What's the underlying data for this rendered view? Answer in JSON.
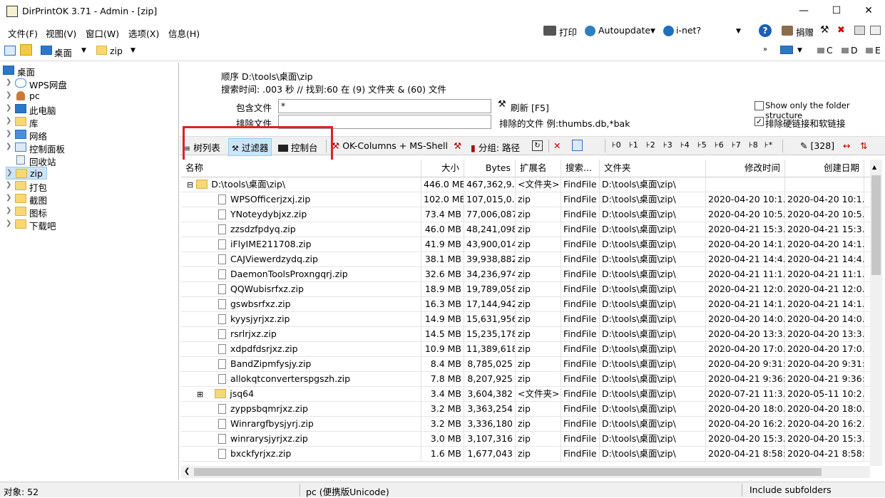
{
  "window": {
    "title": "DirPrintOK 3.71 - Admin - [zip]"
  },
  "menu": [
    "文件(F)",
    "视图(V)",
    "窗口(W)",
    "选项(X)",
    "信息(H)"
  ],
  "toolbar": {
    "print": "打印",
    "autoupdate": "Autoupdate",
    "inet": "i-net?",
    "donate": "捐赠"
  },
  "nav": {
    "desktop": "桌面",
    "zip": "zip",
    "drives": [
      "C",
      "D",
      "E"
    ]
  },
  "tree": [
    {
      "label": "桌面",
      "icon": "desktop-icon"
    },
    {
      "label": "WPS网盘",
      "icon": "cloud-icon"
    },
    {
      "label": "pc",
      "icon": "user-icon"
    },
    {
      "label": "此电脑",
      "icon": "computer-icon"
    },
    {
      "label": "库",
      "icon": "library-icon"
    },
    {
      "label": "网络",
      "icon": "network-icon"
    },
    {
      "label": "控制面板",
      "icon": "control-panel-icon"
    },
    {
      "label": "回收站",
      "icon": "recycle-bin-icon"
    },
    {
      "label": "zip",
      "icon": "folder-icon"
    },
    {
      "label": "打包",
      "icon": "folder-icon"
    },
    {
      "label": "截图",
      "icon": "folder-icon"
    },
    {
      "label": "图标",
      "icon": "folder-icon"
    },
    {
      "label": "下载吧",
      "icon": "folder-icon"
    }
  ],
  "info": {
    "order": "顺序   D:\\tools\\桌面\\zip",
    "search": "搜索时间: .003 秒 //  找到:60 在 (9) 文件夹 & (60) 文件"
  },
  "filter": {
    "include_label": "包含文件",
    "include_value": "*",
    "exclude_label": "排除文件",
    "exclude_value": "",
    "refresh": "刷新 [F5]",
    "exclude_hint": "排除的文件 例:thumbs.db,*bak",
    "only_folder": "Show only the folder structure",
    "exclude_links": "排除硬链接和软链接"
  },
  "toolbar3": {
    "treelist": "树列表",
    "filter": "过滤器",
    "console": "控制台",
    "ok_columns": "OK-Columns + MS-Shell",
    "group": "分组: 路径",
    "levels": [
      "0",
      "1",
      "2",
      "3",
      "4",
      "5",
      "6",
      "7",
      "8",
      "*"
    ],
    "count": "[328]"
  },
  "columns": [
    "名称",
    "大小",
    "Bytes",
    "扩展名",
    "搜索...",
    "文件夹",
    "修改时间",
    "创建日期"
  ],
  "rows": [
    {
      "name": "D:\\tools\\桌面\\zip\\",
      "size": "446.0 MB",
      "bytes": "467,362,9...",
      "ext": "<文件夹>",
      "search": "FindFile",
      "folder": "D:\\tools\\桌面\\zip\\",
      "mtime": "",
      "ctime": "",
      "type": "root"
    },
    {
      "name": "WPSOfficerjzxj.zip",
      "size": "102.0 MB",
      "bytes": "107,015,0...",
      "ext": "zip",
      "search": "FindFile",
      "folder": "D:\\tools\\桌面\\zip\\",
      "mtime": "2020-04-20 10:1...",
      "ctime": "2020-04-20 10:1...",
      "type": "file"
    },
    {
      "name": "YNoteydybjxz.zip",
      "size": "73.4 MB",
      "bytes": "77,006,087",
      "ext": "zip",
      "search": "FindFile",
      "folder": "D:\\tools\\桌面\\zip\\",
      "mtime": "2020-04-20 10:5...",
      "ctime": "2020-04-20 10:5...",
      "type": "file"
    },
    {
      "name": "zzsdzfpdyq.zip",
      "size": "46.0 MB",
      "bytes": "48,241,098",
      "ext": "zip",
      "search": "FindFile",
      "folder": "D:\\tools\\桌面\\zip\\",
      "mtime": "2020-04-21 15:3...",
      "ctime": "2020-04-21 15:3...",
      "type": "file"
    },
    {
      "name": "iFlyIME211708.zip",
      "size": "41.9 MB",
      "bytes": "43,900,014",
      "ext": "zip",
      "search": "FindFile",
      "folder": "D:\\tools\\桌面\\zip\\",
      "mtime": "2020-04-20 14:1...",
      "ctime": "2020-04-20 14:1...",
      "type": "file"
    },
    {
      "name": "CAJViewerdzydq.zip",
      "size": "38.1 MB",
      "bytes": "39,938,882",
      "ext": "zip",
      "search": "FindFile",
      "folder": "D:\\tools\\桌面\\zip\\",
      "mtime": "2020-04-21 14:4...",
      "ctime": "2020-04-21 14:4...",
      "type": "file"
    },
    {
      "name": "DaemonToolsProxngqrj.zip",
      "size": "32.6 MB",
      "bytes": "34,236,974",
      "ext": "zip",
      "search": "FindFile",
      "folder": "D:\\tools\\桌面\\zip\\",
      "mtime": "2020-04-21 11:1...",
      "ctime": "2020-04-21 11:1...",
      "type": "file"
    },
    {
      "name": "QQWubisrfxz.zip",
      "size": "18.9 MB",
      "bytes": "19,789,058",
      "ext": "zip",
      "search": "FindFile",
      "folder": "D:\\tools\\桌面\\zip\\",
      "mtime": "2020-04-21 12:0...",
      "ctime": "2020-04-21 12:0...",
      "type": "file"
    },
    {
      "name": "gswbsrfxz.zip",
      "size": "16.3 MB",
      "bytes": "17,144,942",
      "ext": "zip",
      "search": "FindFile",
      "folder": "D:\\tools\\桌面\\zip\\",
      "mtime": "2020-04-21 14:1...",
      "ctime": "2020-04-21 14:1...",
      "type": "file"
    },
    {
      "name": "kyysjyrjxz.zip",
      "size": "14.9 MB",
      "bytes": "15,631,956",
      "ext": "zip",
      "search": "FindFile",
      "folder": "D:\\tools\\桌面\\zip\\",
      "mtime": "2020-04-20 14:0...",
      "ctime": "2020-04-20 14:0...",
      "type": "file"
    },
    {
      "name": "rsrlrjxz.zip",
      "size": "14.5 MB",
      "bytes": "15,235,178",
      "ext": "zip",
      "search": "FindFile",
      "folder": "D:\\tools\\桌面\\zip\\",
      "mtime": "2020-04-20 13:3...",
      "ctime": "2020-04-20 13:3...",
      "type": "file"
    },
    {
      "name": "xdpdfdsrjxz.zip",
      "size": "10.9 MB",
      "bytes": "11,389,618",
      "ext": "zip",
      "search": "FindFile",
      "folder": "D:\\tools\\桌面\\zip\\",
      "mtime": "2020-04-20 17:0...",
      "ctime": "2020-04-20 17:0...",
      "type": "file"
    },
    {
      "name": "BandZipmfysjy.zip",
      "size": "8.4 MB",
      "bytes": "8,785,025",
      "ext": "zip",
      "search": "FindFile",
      "folder": "D:\\tools\\桌面\\zip\\",
      "mtime": "2020-04-20 9:31:...",
      "ctime": "2020-04-20 9:31:...",
      "type": "file"
    },
    {
      "name": "allokqtconverterspgszh.zip",
      "size": "7.8 MB",
      "bytes": "8,207,925",
      "ext": "zip",
      "search": "FindFile",
      "folder": "D:\\tools\\桌面\\zip\\",
      "mtime": "2020-04-21 9:36:...",
      "ctime": "2020-04-21 9:36:...",
      "type": "file"
    },
    {
      "name": "jsq64",
      "size": "3.4 MB",
      "bytes": "3,604,382",
      "ext": "<文件夹>",
      "search": "FindFile",
      "folder": "D:\\tools\\桌面\\zip\\",
      "mtime": "2020-07-21 11:3...",
      "ctime": "2020-05-11 10:2...",
      "type": "folder"
    },
    {
      "name": "zyppsbqmrjxz.zip",
      "size": "3.2 MB",
      "bytes": "3,363,254",
      "ext": "zip",
      "search": "FindFile",
      "folder": "D:\\tools\\桌面\\zip\\",
      "mtime": "2020-04-20 18:0...",
      "ctime": "2020-04-20 18:0...",
      "type": "file"
    },
    {
      "name": "Winrargfbysjyrj.zip",
      "size": "3.2 MB",
      "bytes": "3,336,180",
      "ext": "zip",
      "search": "FindFile",
      "folder": "D:\\tools\\桌面\\zip\\",
      "mtime": "2020-04-20 16:2...",
      "ctime": "2020-04-20 16:2...",
      "type": "file"
    },
    {
      "name": "winrarysjyrjxz.zip",
      "size": "3.0 MB",
      "bytes": "3,107,316",
      "ext": "zip",
      "search": "FindFile",
      "folder": "D:\\tools\\桌面\\zip\\",
      "mtime": "2020-04-20 15:3...",
      "ctime": "2020-04-20 15:3...",
      "type": "file"
    },
    {
      "name": "bxckfyrjxz.zip",
      "size": "1.6 MB",
      "bytes": "1,677,043",
      "ext": "zip",
      "search": "FindFile",
      "folder": "D:\\tools\\桌面\\zip\\",
      "mtime": "2020-04-21 8:58:...",
      "ctime": "2020-04-21 8:58:...",
      "type": "file"
    }
  ],
  "status": {
    "objects": "对象: 52",
    "user": "pc (便携版Unicode)",
    "subfolders": "Include subfolders"
  }
}
